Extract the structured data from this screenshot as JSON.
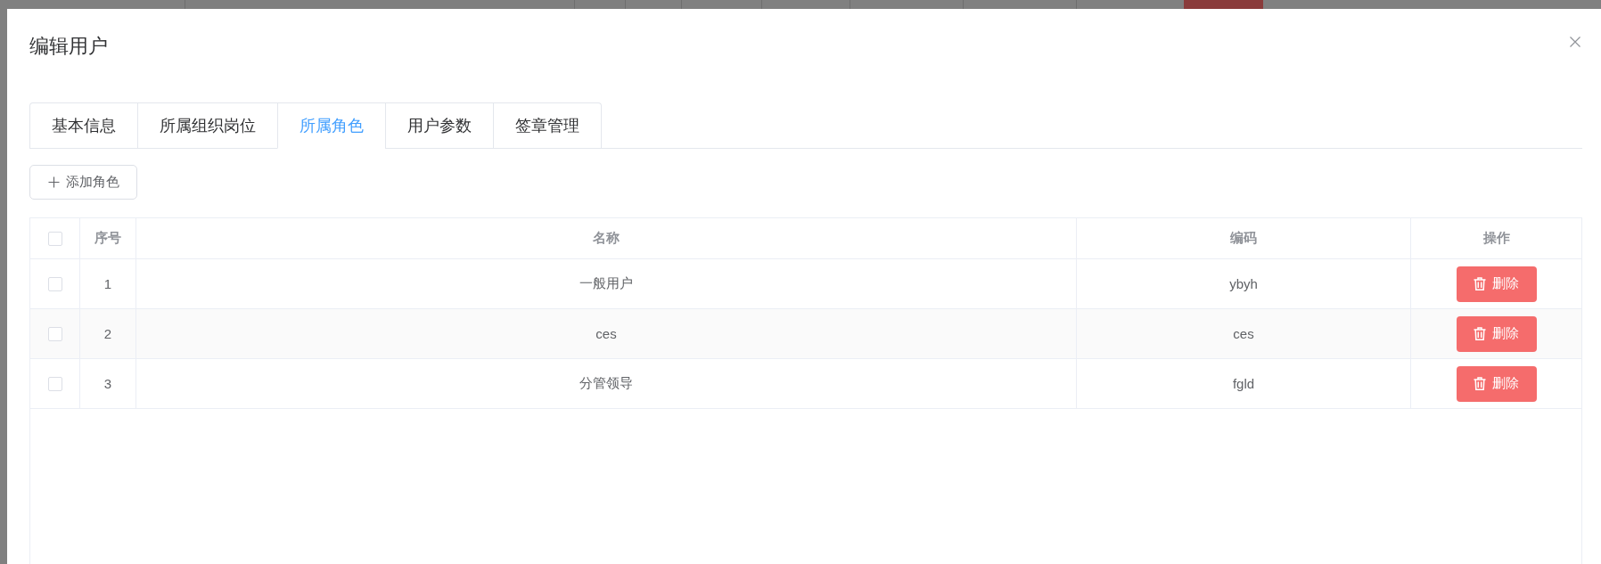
{
  "dialog": {
    "title": "编辑用户"
  },
  "tabs": [
    {
      "label": "基本信息",
      "selected": false
    },
    {
      "label": "所属组织岗位",
      "selected": false
    },
    {
      "label": "所属角色",
      "selected": true
    },
    {
      "label": "用户参数",
      "selected": false
    },
    {
      "label": "签章管理",
      "selected": false
    }
  ],
  "add_button": {
    "label": "添加角色"
  },
  "table": {
    "select_all": {
      "checked": false
    },
    "columns": [
      {
        "label": "序号"
      },
      {
        "label": "名称"
      },
      {
        "label": "编码"
      },
      {
        "label": "操作"
      }
    ],
    "rows": [
      {
        "checked": false,
        "index": "1",
        "name": "一般用户",
        "code": "ybyh",
        "action": "删除"
      },
      {
        "checked": false,
        "index": "2",
        "name": "ces",
        "code": "ces",
        "action": "删除"
      },
      {
        "checked": false,
        "index": "3",
        "name": "分管领导",
        "code": "fgld",
        "action": "删除"
      }
    ]
  }
}
